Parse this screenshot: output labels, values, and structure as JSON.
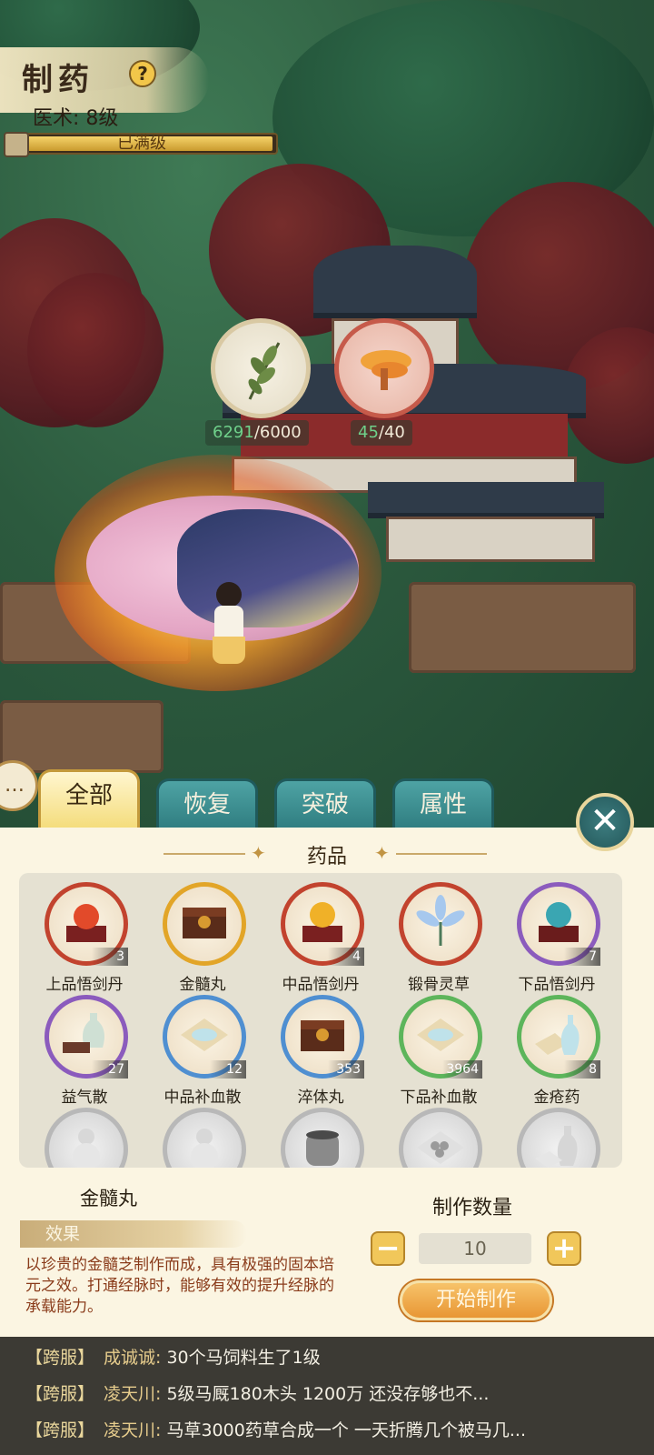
{
  "header": {
    "title": "制药",
    "help_label": "?",
    "skill_level": "医术: 8级",
    "progress_text": "已满级",
    "progress_fraction": 1.0
  },
  "resources": [
    {
      "name": "herb",
      "current": "6291",
      "max": "/6000",
      "icon": "herb-leaf-icon"
    },
    {
      "name": "mushroom",
      "current": "45",
      "max": "/40",
      "icon": "lingzhi-mushroom-icon"
    }
  ],
  "tabs": [
    {
      "label": "全部",
      "active": true
    },
    {
      "label": "恢复",
      "active": false
    },
    {
      "label": "突破",
      "active": false
    },
    {
      "label": "属性",
      "active": false
    }
  ],
  "close_label": "✕",
  "section_title": "药品",
  "items": [
    {
      "name": "上品悟剑丹",
      "count": "3",
      "ring": "red",
      "icon": "red-orb-on-box-icon"
    },
    {
      "name": "金髓丸",
      "count": "",
      "ring": "gold",
      "icon": "pill-in-chest-icon"
    },
    {
      "name": "中品悟剑丹",
      "count": "4",
      "ring": "red",
      "icon": "gold-orb-on-box-icon"
    },
    {
      "name": "锻骨灵草",
      "count": "",
      "ring": "red",
      "icon": "blue-flower-icon"
    },
    {
      "name": "下品悟剑丹",
      "count": "7",
      "ring": "purple",
      "icon": "teal-orb-on-box-icon"
    },
    {
      "name": "益气散",
      "count": "27",
      "ring": "purple",
      "icon": "vase-with-beads-icon"
    },
    {
      "name": "中品补血散",
      "count": "12",
      "ring": "blue",
      "icon": "powder-on-paper-icon"
    },
    {
      "name": "淬体丸",
      "count": "353",
      "ring": "blue",
      "icon": "pill-in-chest-icon"
    },
    {
      "name": "下品补血散",
      "count": "3964",
      "ring": "green",
      "icon": "powder-on-paper-icon"
    },
    {
      "name": "金疮药",
      "count": "8",
      "ring": "green",
      "icon": "potion-bottle-icon"
    },
    {
      "name": "",
      "count": "",
      "ring": "grey",
      "icon": "gourd-bottle-icon"
    },
    {
      "name": "",
      "count": "",
      "ring": "grey",
      "icon": "gourd-bottle-icon"
    },
    {
      "name": "",
      "count": "",
      "ring": "grey",
      "icon": "jar-icon"
    },
    {
      "name": "",
      "count": "",
      "ring": "grey",
      "icon": "pills-on-paper-icon"
    },
    {
      "name": "",
      "count": "",
      "ring": "grey",
      "icon": "vase-icon"
    }
  ],
  "detail": {
    "name": "金髓丸",
    "effect_label": "效果",
    "description": "以珍贵的金髓芝制作而成，具有极强的固本培元之效。打通经脉时，能够有效的提升经脉的承载能力。"
  },
  "craft": {
    "quantity_label": "制作数量",
    "minus_label": "−",
    "plus_label": "+",
    "quantity": "10",
    "start_label": "开始制作"
  },
  "chat": [
    {
      "channel": "【跨服】",
      "name": "成诚诚:",
      "text": "30个马饲料生了1级"
    },
    {
      "channel": "【跨服】",
      "name": "凌天川:",
      "text": "5级马厩180木头 1200万 还没存够也不..."
    },
    {
      "channel": "【跨服】",
      "name": "凌天川:",
      "text": "马草3000药草合成一个 一天折腾几个被马几..."
    }
  ]
}
